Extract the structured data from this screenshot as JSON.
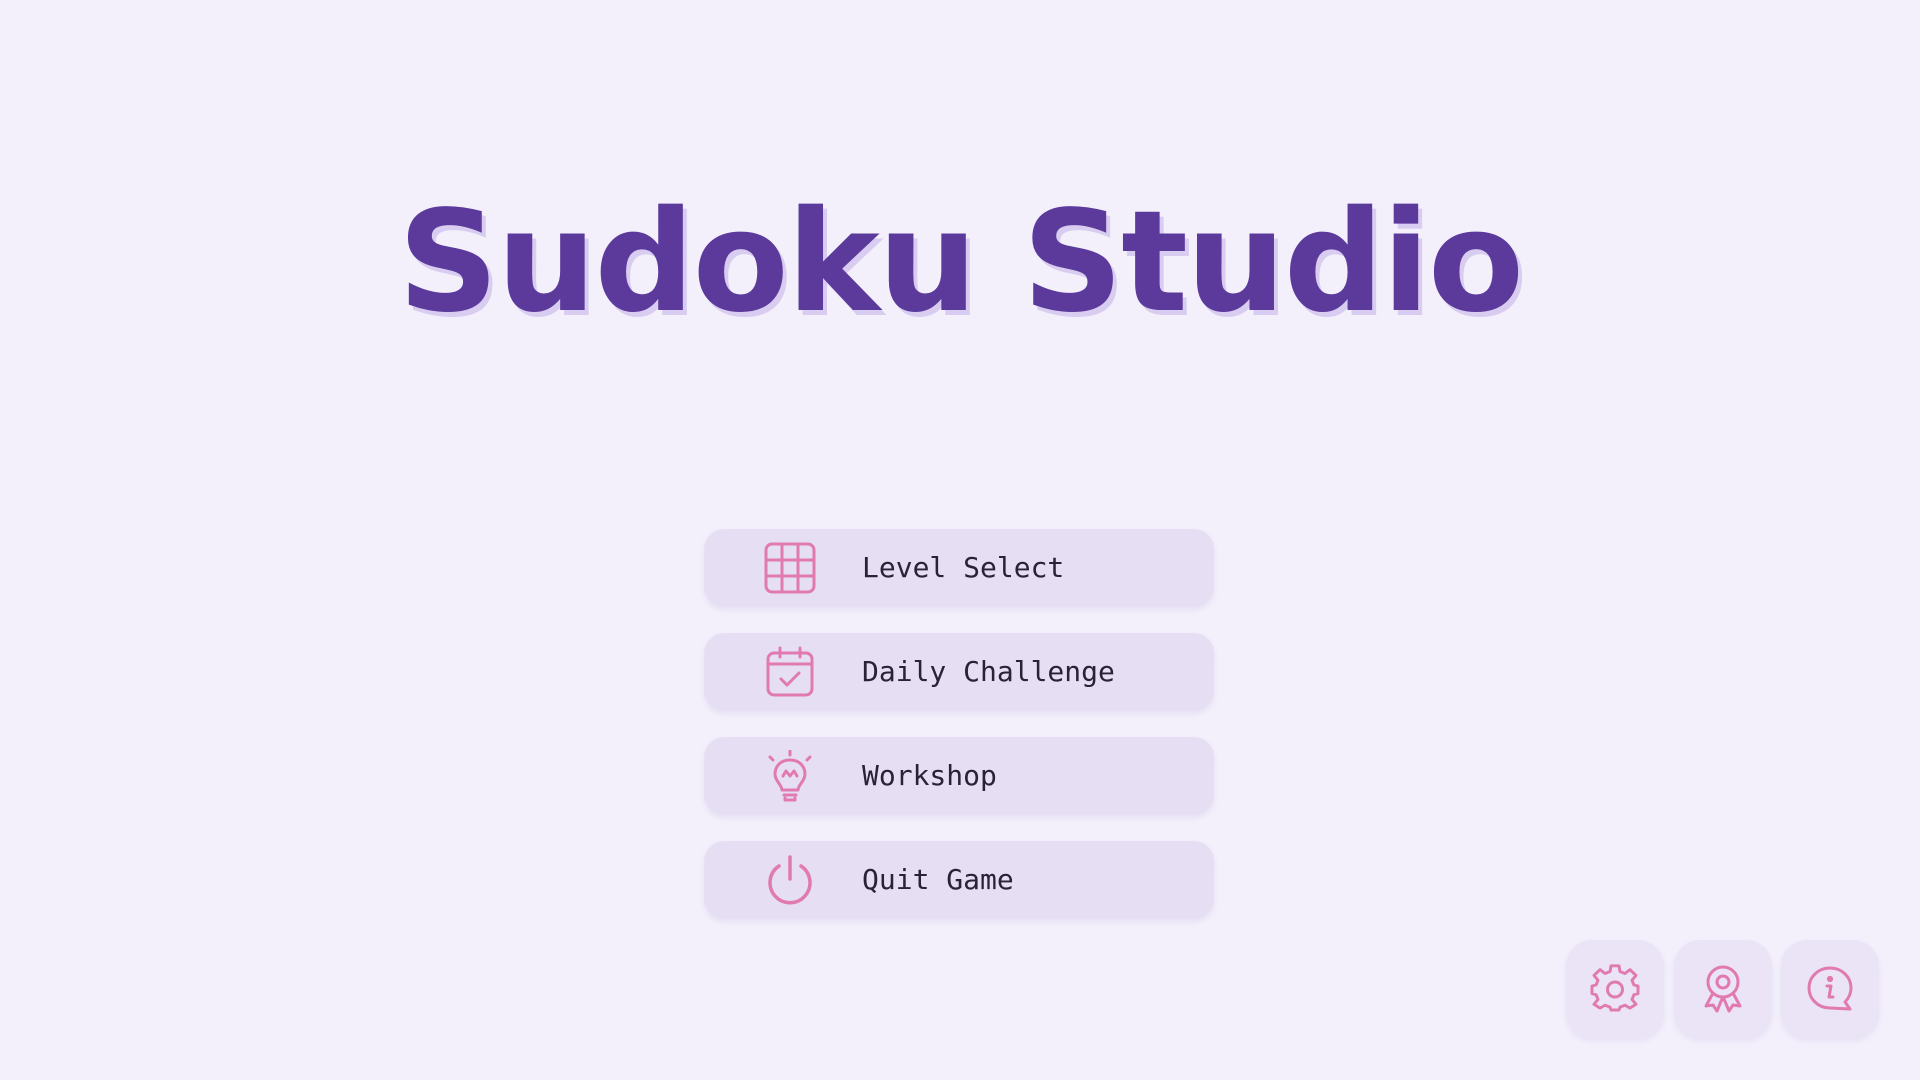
{
  "title": "Sudoku Studio",
  "colors": {
    "background": "#f3f0fc",
    "title": "#5b3a9c",
    "button_bg": "#e6dff3",
    "icon": "#e07ab0",
    "label": "#2a2236"
  },
  "menu": {
    "items": [
      {
        "label": "Level Select",
        "icon": "grid-icon"
      },
      {
        "label": "Daily Challenge",
        "icon": "calendar-check-icon"
      },
      {
        "label": "Workshop",
        "icon": "lightbulb-icon"
      },
      {
        "label": "Quit Game",
        "icon": "power-icon"
      }
    ]
  },
  "corner_buttons": [
    {
      "icon": "gear-icon"
    },
    {
      "icon": "award-ribbon-icon"
    },
    {
      "icon": "info-chat-icon"
    }
  ]
}
